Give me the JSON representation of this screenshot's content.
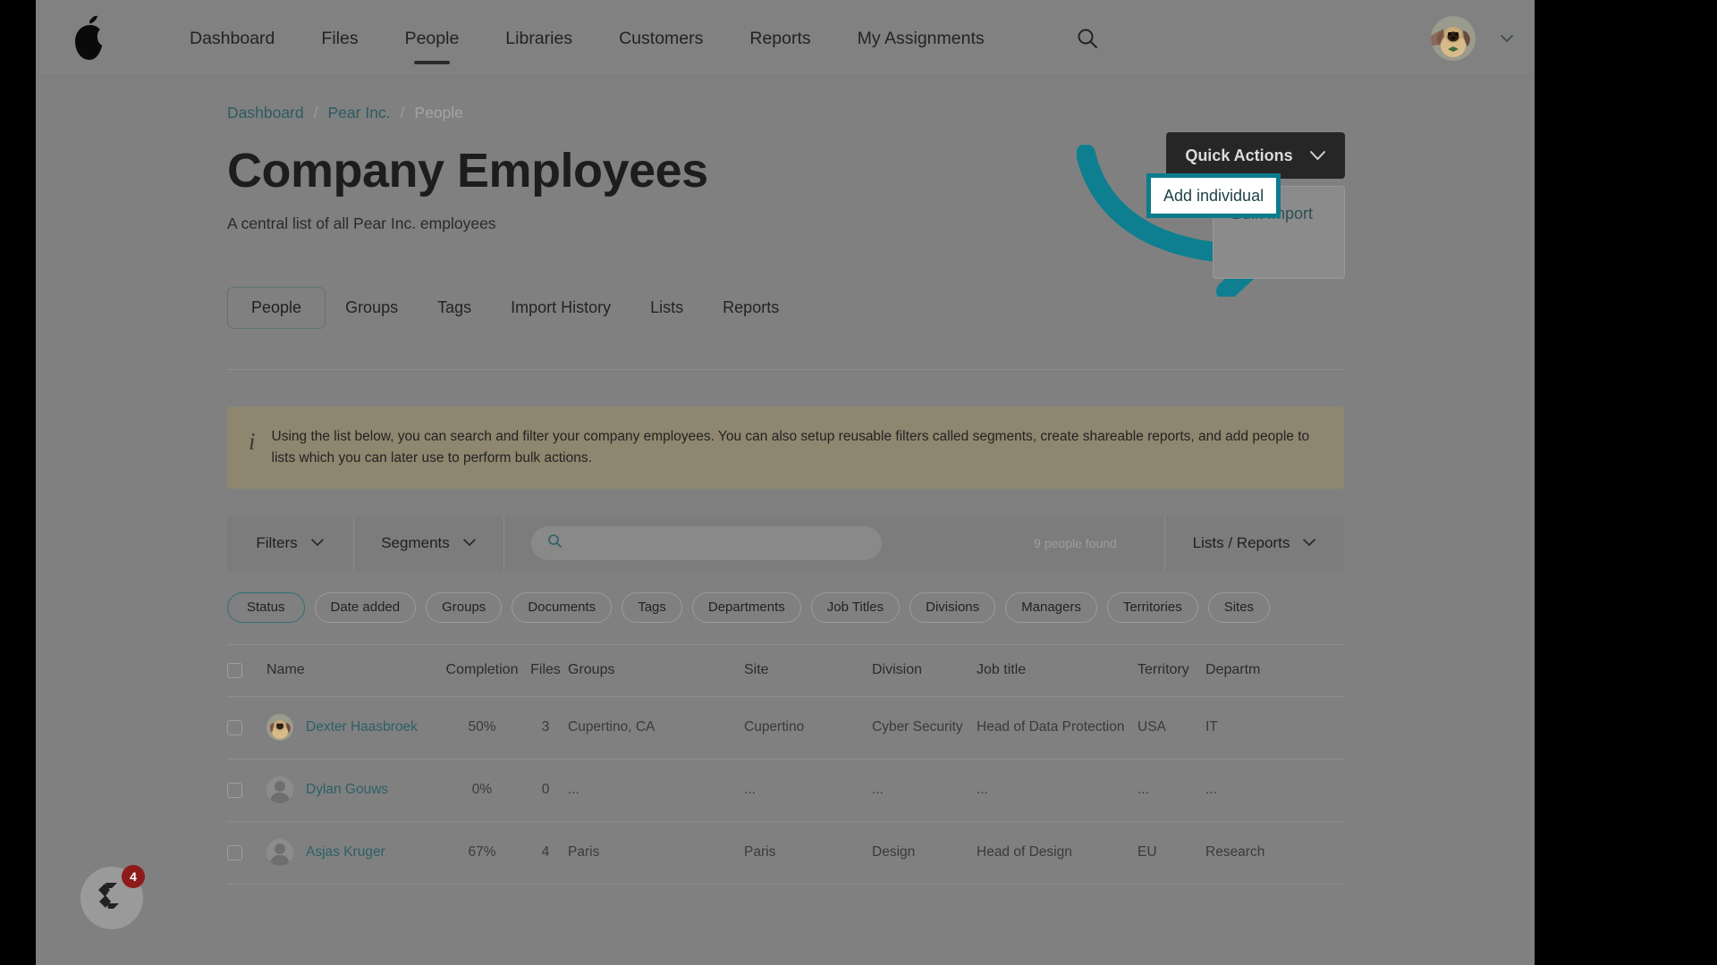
{
  "nav": {
    "logo_icon": "pear-logo-icon",
    "links": [
      {
        "label": "Dashboard",
        "active": false
      },
      {
        "label": "Files",
        "active": false
      },
      {
        "label": "People",
        "active": true
      },
      {
        "label": "Libraries",
        "active": false
      },
      {
        "label": "Customers",
        "active": false
      },
      {
        "label": "Reports",
        "active": false
      },
      {
        "label": "My Assignments",
        "active": false
      }
    ],
    "search_icon": "search-icon",
    "avatar_icon": "user-avatar",
    "avatar_chevron_icon": "chevron-down-icon"
  },
  "breadcrumb": {
    "items": [
      "Dashboard",
      "Pear Inc.",
      "People"
    ],
    "separator": "/"
  },
  "header": {
    "title": "Company Employees",
    "subtitle": "A central list of all Pear Inc. employees"
  },
  "quick_actions": {
    "button_label": "Quick Actions",
    "chevron_icon": "chevron-down-icon",
    "menu_items": [
      "Bulk Import",
      "Add individual"
    ],
    "highlighted_item": "Add individual",
    "highlight_color": "#0b7c8c"
  },
  "annotation": {
    "arrow_icon": "curved-arrow-right-icon",
    "arrow_color": "#0d7f90"
  },
  "tabs": [
    {
      "label": "People",
      "active": true
    },
    {
      "label": "Groups",
      "active": false
    },
    {
      "label": "Tags",
      "active": false
    },
    {
      "label": "Import History",
      "active": false
    },
    {
      "label": "Lists",
      "active": false
    },
    {
      "label": "Reports",
      "active": false
    }
  ],
  "info_banner": {
    "icon": "info-icon",
    "text": "Using the list below, you can search and filter your company employees. You can also setup reusable filters called segments, create shareable reports, and add people to lists which you can later use to perform bulk actions."
  },
  "toolbar": {
    "filters_label": "Filters",
    "segments_label": "Segments",
    "search_placeholder": "",
    "search_value": "",
    "search_icon": "search-icon",
    "count_label": "9 people found",
    "lists_reports_label": "Lists / Reports",
    "chevron_icon": "chevron-down-icon"
  },
  "filter_chips": [
    {
      "label": "Status",
      "selected": true
    },
    {
      "label": "Date added",
      "selected": false
    },
    {
      "label": "Groups",
      "selected": false
    },
    {
      "label": "Documents",
      "selected": false
    },
    {
      "label": "Tags",
      "selected": false
    },
    {
      "label": "Departments",
      "selected": false
    },
    {
      "label": "Job Titles",
      "selected": false
    },
    {
      "label": "Divisions",
      "selected": false
    },
    {
      "label": "Managers",
      "selected": false
    },
    {
      "label": "Territories",
      "selected": false
    },
    {
      "label": "Sites",
      "selected": false
    }
  ],
  "table": {
    "columns": [
      "Name",
      "Completion",
      "Files",
      "Groups",
      "Site",
      "Division",
      "Job title",
      "Territory",
      "Departm"
    ],
    "rows": [
      {
        "name": "Dexter Haasbroek",
        "completion": "50%",
        "files": "3",
        "groups": "Cupertino, CA",
        "site": "Cupertino",
        "division": "Cyber Security",
        "job_title": "Head of Data Protection",
        "territory": "USA",
        "department": "IT",
        "has_photo": true
      },
      {
        "name": "Dylan Gouws",
        "completion": "0%",
        "files": "0",
        "groups": "...",
        "site": "...",
        "division": "...",
        "job_title": "...",
        "territory": "...",
        "department": "...",
        "has_photo": false
      },
      {
        "name": "Asjas Kruger",
        "completion": "67%",
        "files": "4",
        "groups": "Paris",
        "site": "Paris",
        "division": "Design",
        "job_title": "Head of Design",
        "territory": "EU",
        "department": "Research",
        "has_photo": false
      }
    ]
  },
  "help_widget": {
    "icon": "help-chat-icon",
    "badge_count": "4",
    "badge_color": "#8e1b1b"
  }
}
